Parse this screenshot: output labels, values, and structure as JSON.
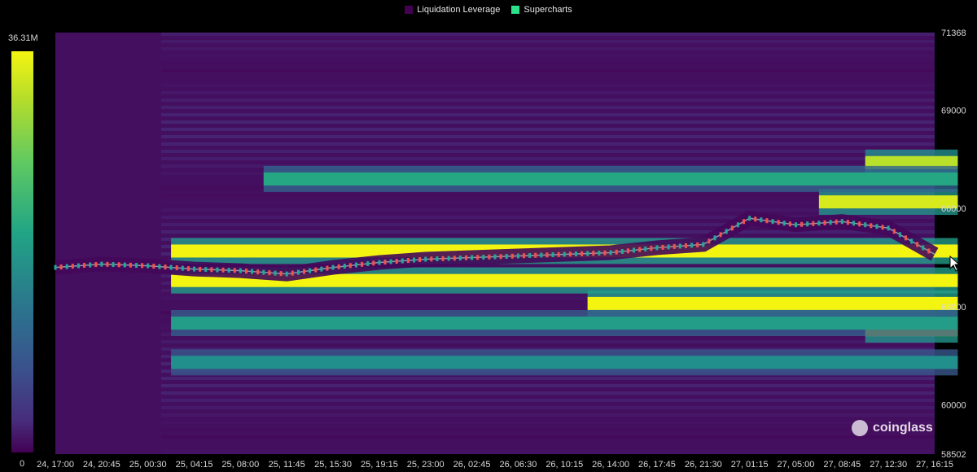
{
  "legend": [
    {
      "label": "Liquidation Leverage",
      "color": "#440154"
    },
    {
      "label": "Supercharts",
      "color": "#2de08a"
    }
  ],
  "colorbar": {
    "max_label": "36.31M",
    "min_label": "0"
  },
  "watermark": {
    "text": "coinglass"
  },
  "chart_data": {
    "type": "heatmap",
    "title": "",
    "xlabel": "",
    "ylabel": "",
    "x_ticks": [
      "24, 17:00",
      "24, 20:45",
      "25, 00:30",
      "25, 04:15",
      "25, 08:00",
      "25, 11:45",
      "25, 15:30",
      "25, 19:15",
      "25, 23:00",
      "26, 02:45",
      "26, 06:30",
      "26, 10:15",
      "26, 14:00",
      "26, 17:45",
      "26, 21:30",
      "27, 01:15",
      "27, 05:00",
      "27, 08:45",
      "27, 12:30",
      "27, 16:15"
    ],
    "y_ticks": [
      71368,
      69000,
      66000,
      63000,
      60000,
      58502
    ],
    "ylim": [
      58502,
      71368
    ],
    "color_scale": {
      "min": 0,
      "max": 36310000,
      "label_min": "0",
      "label_max": "36.31M",
      "colormap": "viridis"
    },
    "price_series": {
      "name": "",
      "x_index": [
        0,
        1,
        2,
        3,
        4,
        5,
        6,
        7,
        8,
        9,
        10,
        11,
        12,
        13,
        14,
        15,
        16,
        17,
        18,
        19
      ],
      "values": [
        64200,
        64300,
        64250,
        64150,
        64100,
        64000,
        64200,
        64350,
        64450,
        64500,
        64550,
        64600,
        64650,
        64800,
        64900,
        65700,
        65500,
        65600,
        65400,
        64600
      ]
    },
    "liquidation_bands": [
      {
        "price": 64700,
        "start_x": 2.5,
        "end_x": 19.5,
        "intensity": 1.0
      },
      {
        "price": 63800,
        "start_x": 2.5,
        "end_x": 19.5,
        "intensity": 1.0
      },
      {
        "price": 63100,
        "start_x": 11.5,
        "end_x": 19.5,
        "intensity": 1.0
      },
      {
        "price": 66200,
        "start_x": 16.5,
        "end_x": 19.5,
        "intensity": 0.95
      },
      {
        "price": 67400,
        "start_x": 17.5,
        "end_x": 19.5,
        "intensity": 0.9
      },
      {
        "price": 62300,
        "start_x": 17.5,
        "end_x": 19.5,
        "intensity": 0.95
      },
      {
        "price": 66900,
        "start_x": 4.5,
        "end_x": 19.5,
        "intensity": 0.6
      },
      {
        "price": 62500,
        "start_x": 2.5,
        "end_x": 19.5,
        "intensity": 0.55
      },
      {
        "price": 61300,
        "start_x": 2.5,
        "end_x": 19.5,
        "intensity": 0.5
      }
    ]
  }
}
